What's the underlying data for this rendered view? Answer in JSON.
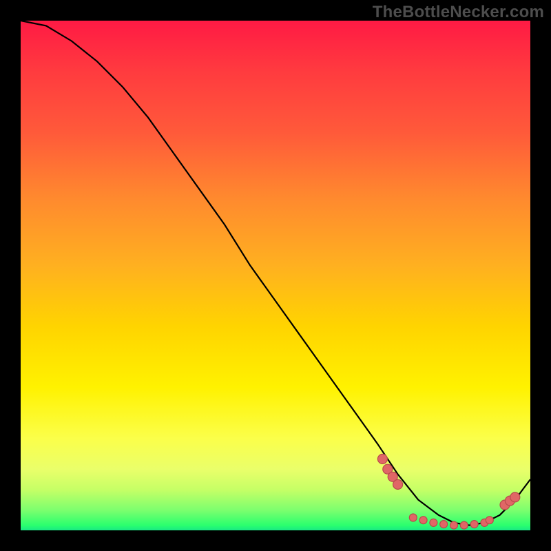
{
  "watermark": "TheBottleNecker.com",
  "colors": {
    "background": "#000000",
    "curve": "#000000",
    "marker_fill": "#e06666",
    "marker_stroke": "#b84b4b"
  },
  "chart_data": {
    "type": "line",
    "title": "",
    "xlabel": "",
    "ylabel": "",
    "xlim": [
      0,
      100
    ],
    "ylim": [
      0,
      100
    ],
    "grid": false,
    "series": [
      {
        "name": "curve",
        "x": [
          0,
          5,
          10,
          15,
          20,
          25,
          30,
          35,
          40,
          45,
          50,
          55,
          60,
          65,
          70,
          74,
          78,
          82,
          85,
          88,
          91,
          94,
          97,
          100
        ],
        "values": [
          100,
          99,
          96,
          92,
          87,
          81,
          74,
          67,
          60,
          52,
          45,
          38,
          31,
          24,
          17,
          11,
          6,
          3,
          1.5,
          1,
          1.5,
          3,
          6,
          10
        ]
      }
    ],
    "markers": [
      {
        "name": "cluster-left",
        "x": [
          71,
          72,
          73,
          74
        ],
        "values": [
          14,
          12,
          10.5,
          9
        ]
      },
      {
        "name": "trough-dots",
        "x": [
          77,
          79,
          81,
          83,
          85,
          87,
          89,
          91,
          92
        ],
        "values": [
          2.5,
          2,
          1.5,
          1.2,
          1,
          1,
          1.2,
          1.5,
          2
        ]
      },
      {
        "name": "cluster-right",
        "x": [
          95,
          96,
          97
        ],
        "values": [
          5,
          5.8,
          6.5
        ]
      }
    ],
    "annotations": [
      {
        "text": "TheBottleNecker.com",
        "position": "top-right"
      }
    ]
  }
}
